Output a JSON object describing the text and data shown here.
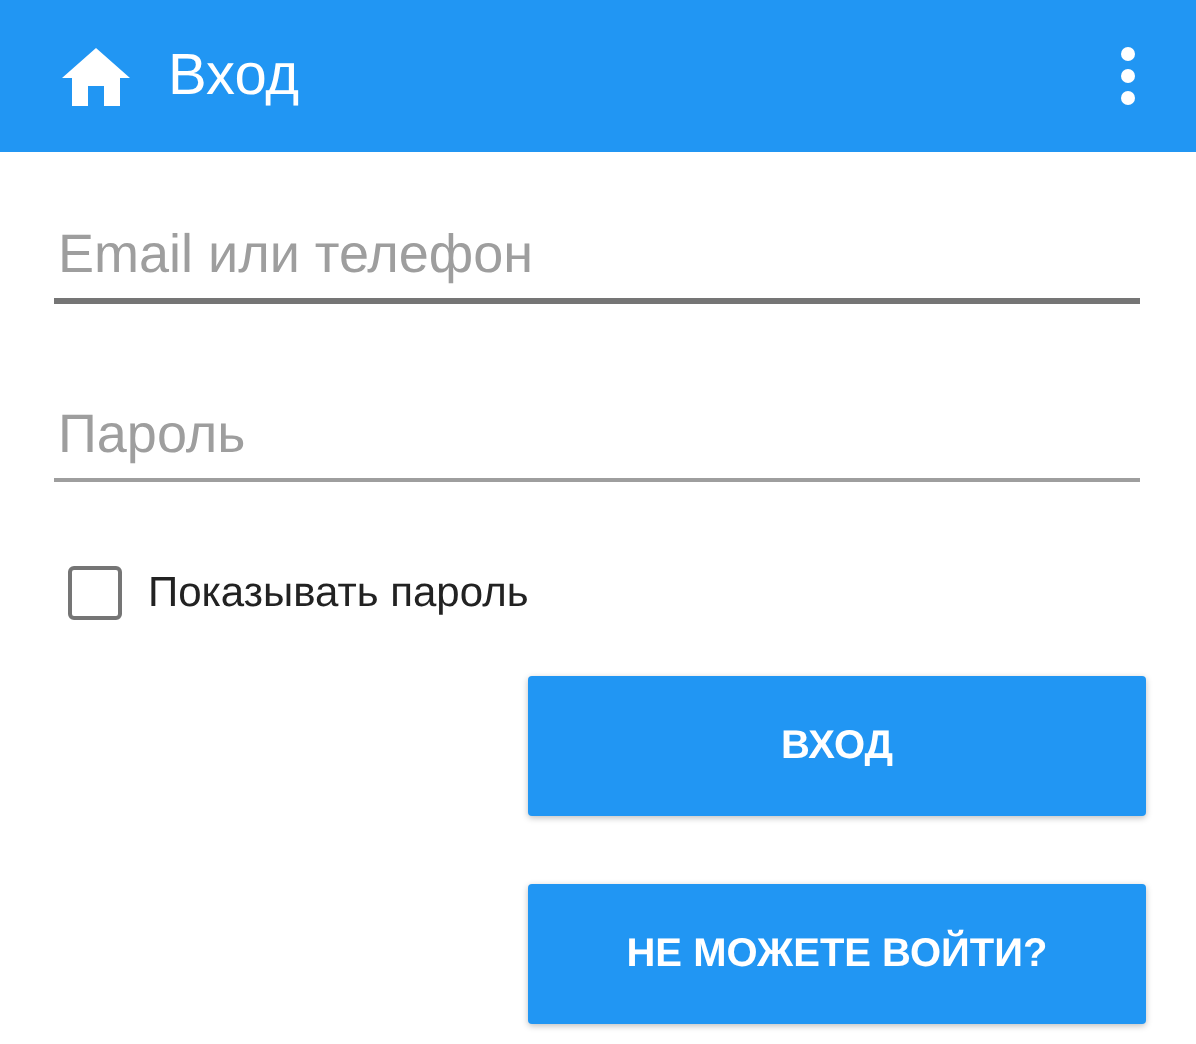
{
  "app_bar": {
    "title": "Вход"
  },
  "fields": [
    {
      "placeholder": "Email или телефон",
      "focused": true
    },
    {
      "placeholder": "Пароль",
      "focused": false
    }
  ],
  "show_password": {
    "label": "Показывать пароль",
    "checked": false
  },
  "buttons": [
    "ВХОД",
    "НЕ МОЖЕТЕ ВОЙТИ?"
  ]
}
